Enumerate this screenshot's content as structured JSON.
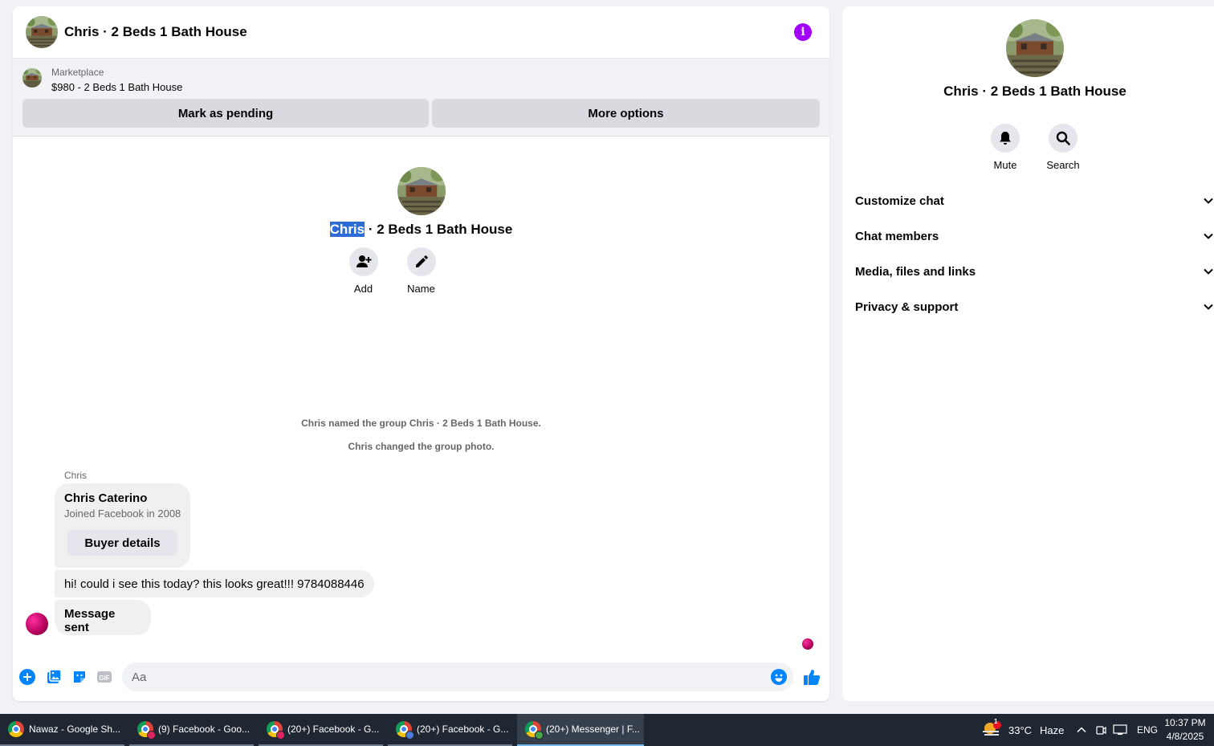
{
  "colors": {
    "accent": "#0084ff",
    "info_button": "#a200ff",
    "selection": "#2d6bd6"
  },
  "chat": {
    "header_title": "Chris · 2 Beds 1 Bath House",
    "marketplace_label": "Marketplace",
    "listing_title": "$980 - 2 Beds 1 Bath House",
    "mark_pending_label": "Mark as pending",
    "more_options_label": "More options",
    "intro_title_selected": "Chris",
    "intro_title_rest": " · 2 Beds 1 Bath House",
    "add_label": "Add",
    "name_label": "Name",
    "system_messages": [
      "Chris named the group Chris · 2 Beds 1 Bath House.",
      "Chris changed the group photo."
    ],
    "sender_name": "Chris",
    "buyer_card": {
      "name": "Chris Caterino",
      "subtitle": "Joined Facebook in 2008",
      "button_label": "Buyer details"
    },
    "message_text": "hi! could i see this today? this looks great!!! 9784088446",
    "sent_text": "Message sent",
    "composer_placeholder": "Aa"
  },
  "info_panel": {
    "title": "Chris · 2 Beds 1 Bath House",
    "mute_label": "Mute",
    "search_label": "Search",
    "sections": [
      "Customize chat",
      "Chat members",
      "Media, files and links",
      "Privacy & support"
    ]
  },
  "taskbar": {
    "tasks": [
      "Nawaz - Google Sh...",
      "(9) Facebook - Goo...",
      "(20+) Facebook - G...",
      "(20+) Facebook - G...",
      "(20+) Messenger | F..."
    ],
    "weather_badge": "1",
    "temperature": "33°C",
    "weather": "Haze",
    "language": "ENG",
    "time": "10:37 PM",
    "date": "4/8/2025"
  }
}
